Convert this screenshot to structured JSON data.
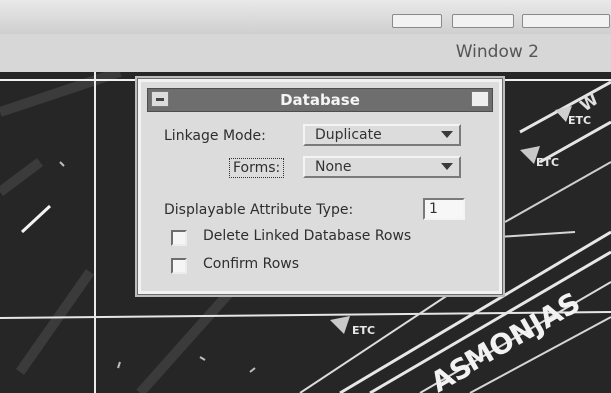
{
  "window": {
    "title": "Window 2"
  },
  "dialog": {
    "title": "Database",
    "linkage_mode": {
      "label": "Linkage Mode:",
      "value": "Duplicate"
    },
    "forms": {
      "label": "Forms:",
      "value": "None"
    },
    "attribute_type": {
      "label": "Displayable Attribute Type:",
      "value": "1"
    },
    "options": [
      {
        "label": "Delete Linked Database Rows",
        "checked": false
      },
      {
        "label": "Confirm Rows",
        "checked": false
      }
    ]
  },
  "map": {
    "labels": {
      "monjas": "MONJAS",
      "as": "AS",
      "etc_a": "ETC",
      "etc_b": "ETC",
      "etc_c": "ETC",
      "wr": "W"
    }
  },
  "icons": {
    "dialog_menu": "window-menu-icon",
    "dialog_maximize": "maximize-icon",
    "dropdown": "chevron-down-icon",
    "checkbox": "checkbox-icon"
  }
}
